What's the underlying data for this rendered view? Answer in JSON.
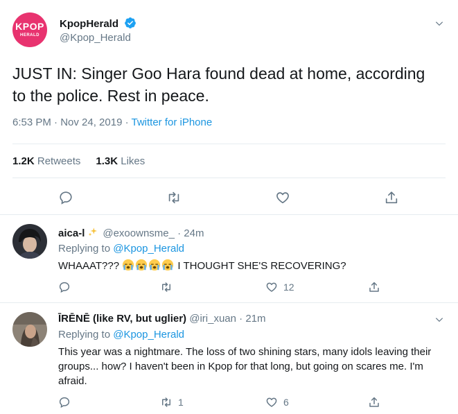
{
  "main_tweet": {
    "logo_line1": "KPOP",
    "logo_line2": "HERALD",
    "author_name": "KpopHerald",
    "author_handle": "@Kpop_Herald",
    "text": "JUST IN: Singer Goo Hara found dead at home, according to the police. Rest in peace.",
    "time": "6:53 PM · Nov 24, 2019 · ",
    "source": "Twitter for iPhone",
    "retweets_count": "1.2K",
    "retweets_label": "Retweets",
    "likes_count": "1.3K",
    "likes_label": "Likes"
  },
  "replies": [
    {
      "name": "aica-l",
      "handle": "@exoownsme_",
      "time": "· 24m",
      "replying_prefix": "Replying to ",
      "replying_to": "@Kpop_Herald",
      "text_before": "WHAAAT??? ",
      "text_after": " I THOUGHT SHE'S RECOVERING?",
      "retweets": "",
      "likes": "12"
    },
    {
      "name": "ĪRĒNĒ (like RV, but uglier)",
      "handle": "@iri_xuan",
      "time": "· 21m",
      "replying_prefix": "Replying to ",
      "replying_to": "@Kpop_Herald",
      "text": "This year was a nightmare. The loss of two shining stars, many idols leaving their groups... how? I haven't been in Kpop for that long, but going on scares me. I'm afraid.",
      "retweets": "1",
      "likes": "6"
    }
  ],
  "colors": {
    "accent": "#1b95e0",
    "muted": "#657786",
    "text": "#14171a",
    "logo_bg": "#e8336f"
  }
}
